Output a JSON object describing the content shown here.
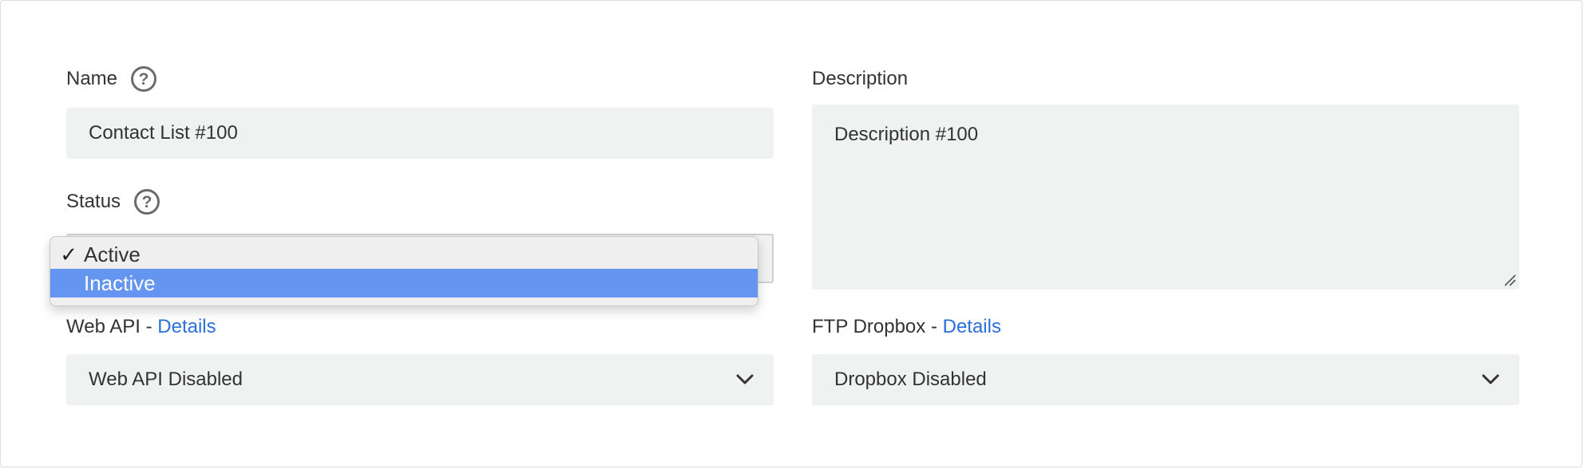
{
  "form": {
    "name": {
      "label": "Name",
      "value": "Contact List #100",
      "help_icon": "question-circle-icon"
    },
    "description": {
      "label": "Description",
      "value": "Description #100"
    },
    "status": {
      "label": "Status",
      "help_icon": "question-circle-icon",
      "options": [
        {
          "label": "Active",
          "checked": true,
          "check_mark": "✓"
        },
        {
          "label": "Inactive",
          "checked": false,
          "highlighted": true
        }
      ]
    },
    "web_api": {
      "label": "Web API - ",
      "link": "Details",
      "value": "Web API Disabled"
    },
    "ftp_dropbox": {
      "label": "FTP Dropbox - ",
      "link": "Details",
      "value": "Dropbox Disabled"
    }
  },
  "colors": {
    "link": "#2a6fdb",
    "field_bg": "#f0f1f1",
    "highlight": "#6495f0"
  }
}
